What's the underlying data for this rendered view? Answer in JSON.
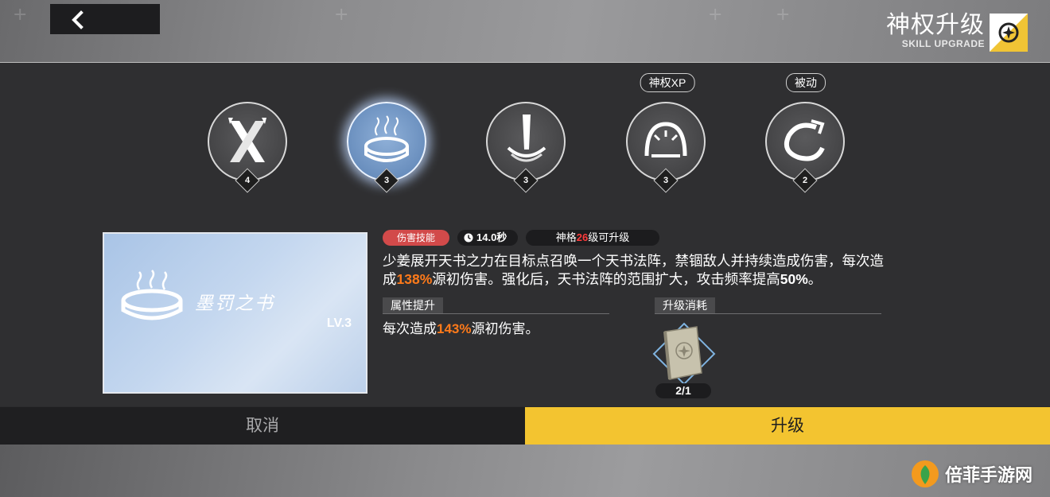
{
  "header": {
    "title": "神权升级",
    "subtitle": "SKILL UPGRADE",
    "accent": "#f0c435"
  },
  "skills": [
    {
      "icon": "crossed-blades-icon",
      "level": "4",
      "tag": ""
    },
    {
      "icon": "book-ring-icon",
      "level": "3",
      "tag": "",
      "selected": true
    },
    {
      "icon": "sword-impact-icon",
      "level": "3",
      "tag": ""
    },
    {
      "icon": "arch-gate-icon",
      "level": "3",
      "tag": "神权XP"
    },
    {
      "icon": "scroll-swirl-icon",
      "level": "2",
      "tag": "被动"
    }
  ],
  "card": {
    "name": "墨罚之书",
    "level": "LV.3"
  },
  "tags": {
    "type": "伤害技能",
    "cooldown": "14.0秒",
    "req_prefix": "神格",
    "req_level": "26",
    "req_suffix": "级可升级"
  },
  "description": {
    "line1": "少姜展开天书之力在目标点召唤一个天书法阵，禁锢敌人并持续造成伤害，每次造",
    "line2_a": "成",
    "line2_pct": "138%",
    "line2_b": "源初伤害。强化后，天书法阵的范围扩大，攻击频率提高",
    "line2_pct2": "50%",
    "line2_c": "。"
  },
  "attr": {
    "heading": "属性提升",
    "text_a": "每次造成",
    "text_pct": "143%",
    "text_b": "源初伤害。"
  },
  "cost": {
    "heading": "升级消耗",
    "item_icon": "skill-book-icon",
    "count": "2/1"
  },
  "buttons": {
    "cancel": "取消",
    "upgrade": "升级"
  },
  "watermark": {
    "text": "倍菲手游网"
  }
}
